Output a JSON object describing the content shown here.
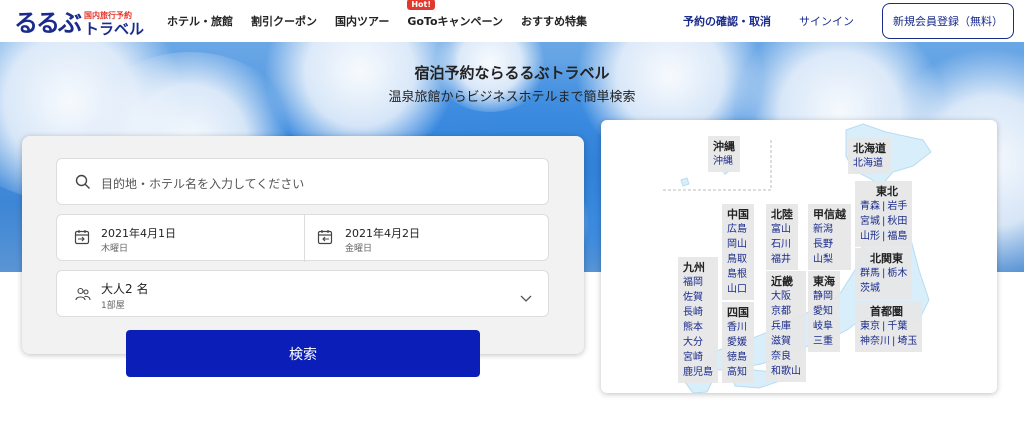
{
  "header": {
    "logo_main": "るるぶ",
    "logo_sub": "国内旅行予約",
    "logo_travel": "トラベル",
    "nav": [
      "ホテル・旅館",
      "割引クーポン",
      "国内ツアー",
      "GoToキャンペーン",
      "おすすめ特集"
    ],
    "hot_badge": "Hot!",
    "reservation_link": "予約の確認・取消",
    "signin": "サインイン",
    "register": "新規会員登録（無料）"
  },
  "hero": {
    "title": "宿泊予約ならるるぶトラベル",
    "subtitle": "温泉旅館からビジネスホテルまで簡単検索"
  },
  "search": {
    "destination_placeholder": "目的地・ホテル名を入力してください",
    "checkin_date": "2021年4月1日",
    "checkin_day": "木曜日",
    "checkout_date": "2021年4月2日",
    "checkout_day": "金曜日",
    "guests": "大人2 名",
    "rooms": "1部屋",
    "button": "検索"
  },
  "map": {
    "okinawa": {
      "name": "沖縄",
      "prefs": [
        "沖縄"
      ]
    },
    "hokkaido": {
      "name": "北海道",
      "prefs": [
        "北海道"
      ]
    },
    "tohoku": {
      "name": "東北",
      "rows": [
        [
          "青森",
          "岩手"
        ],
        [
          "宮城",
          "秋田"
        ],
        [
          "山形",
          "福島"
        ]
      ]
    },
    "kitakanto": {
      "name": "北関東",
      "rows": [
        [
          "群馬",
          "栃木"
        ],
        [
          "茨城"
        ]
      ]
    },
    "shutoken": {
      "name": "首都圏",
      "rows": [
        [
          "東京",
          "千葉"
        ],
        [
          "神奈川",
          "埼玉"
        ]
      ]
    },
    "koshinetsu": {
      "name": "甲信越",
      "prefs": [
        "新潟",
        "長野",
        "山梨"
      ]
    },
    "tokai": {
      "name": "東海",
      "prefs": [
        "静岡",
        "愛知",
        "岐阜",
        "三重"
      ]
    },
    "hokuriku": {
      "name": "北陸",
      "prefs": [
        "富山",
        "石川",
        "福井"
      ]
    },
    "kinki": {
      "name": "近畿",
      "prefs": [
        "大阪",
        "京都",
        "兵庫",
        "滋賀",
        "奈良",
        "和歌山"
      ]
    },
    "chugoku": {
      "name": "中国",
      "prefs": [
        "広島",
        "岡山",
        "鳥取",
        "島根",
        "山口"
      ]
    },
    "shikoku": {
      "name": "四国",
      "prefs": [
        "香川",
        "愛媛",
        "徳島",
        "高知"
      ]
    },
    "kyushu": {
      "name": "九州",
      "prefs": [
        "福岡",
        "佐賀",
        "長崎",
        "熊本",
        "大分",
        "宮崎",
        "鹿児島"
      ]
    }
  }
}
